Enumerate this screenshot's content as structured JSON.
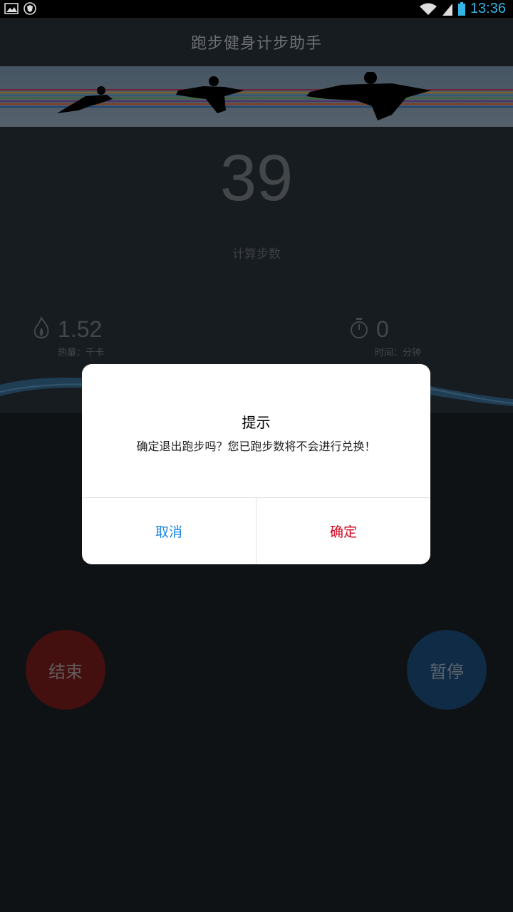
{
  "status_bar": {
    "time": "13:36"
  },
  "app": {
    "title": "跑步健身计步助手"
  },
  "stats": {
    "steps": "39",
    "steps_label": "计算步数",
    "calories_value": "1.52",
    "calories_label": "热量：千卡",
    "time_value": "0",
    "time_label": "时间：分钟"
  },
  "dialog": {
    "title": "提示",
    "message": "确定退出跑步吗？您已跑步数将不会进行兑换！",
    "cancel_label": "取消",
    "confirm_label": "确定"
  },
  "controls": {
    "end_label": "结束",
    "pause_label": "暂停"
  },
  "colors": {
    "accent_status": "#33b5e5",
    "cancel": "#1e88e5",
    "confirm": "#d0021b",
    "end_button": "#7a1d1d",
    "pause_button": "#1d4f7e"
  },
  "icons": [
    "image-icon",
    "shield-icon",
    "wifi-icon",
    "signal-icon",
    "battery-icon",
    "flame-icon",
    "stopwatch-icon"
  ]
}
